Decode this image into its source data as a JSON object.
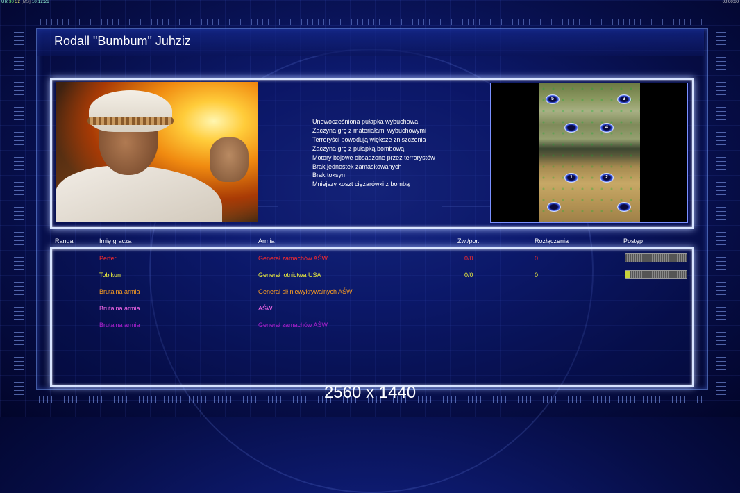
{
  "status": {
    "left_prefix": "UR",
    "fps": "30",
    "ping": "32",
    "server": "[MS]",
    "time": "10:12:26",
    "right_clock": "00:00:00"
  },
  "player_name": "Rodall \"Bumbum\" Juhziz",
  "features": [
    "Unowocześniona pułapka wybuchowa",
    "Zaczyna grę z materiałami wybuchowymi",
    "Terroryści powodują większe zniszczenia",
    "Zaczyna grę z pułapką bombową",
    "Motory bojowe obsadzone przez terrorystów",
    "Brak jednostek zamaskowanych",
    "Brak toksyn",
    "Mniejszy koszt ciężarówki z bombą"
  ],
  "map": {
    "spawns": [
      "5",
      "3",
      "",
      "4",
      "1",
      "2",
      "",
      ""
    ]
  },
  "table": {
    "headers": {
      "rank": "Ranga",
      "name": "Imię gracza",
      "army": "Armia",
      "wins": "Zw./por.",
      "disconnects": "Rozłączenia",
      "progress": "Postęp"
    },
    "rows": [
      {
        "name": "Perfer",
        "army": "Generał zamachów AŚW",
        "wins": "0/0",
        "disconnects": "0",
        "color": "#ff2a2a",
        "progress": 0.0
      },
      {
        "name": "Tobikun",
        "army": "Generał lotnictwa USA",
        "wins": "0/0",
        "disconnects": "0",
        "color": "#f4f43a",
        "progress": 0.08
      },
      {
        "name": "Brutalna armia",
        "army": "Generał sił niewykrywalnych AŚW",
        "wins": "",
        "disconnects": "",
        "color": "#ffa020",
        "progress": null
      },
      {
        "name": "Brutalna armia",
        "army": "AŚW",
        "wins": "",
        "disconnects": "",
        "color": "#ff6af0",
        "progress": null
      },
      {
        "name": "Brutalna armia",
        "army": "Generał zamachów AŚW",
        "wins": "",
        "disconnects": "",
        "color": "#b020d0",
        "progress": null
      }
    ]
  },
  "resolution_label": "2560 x 1440"
}
